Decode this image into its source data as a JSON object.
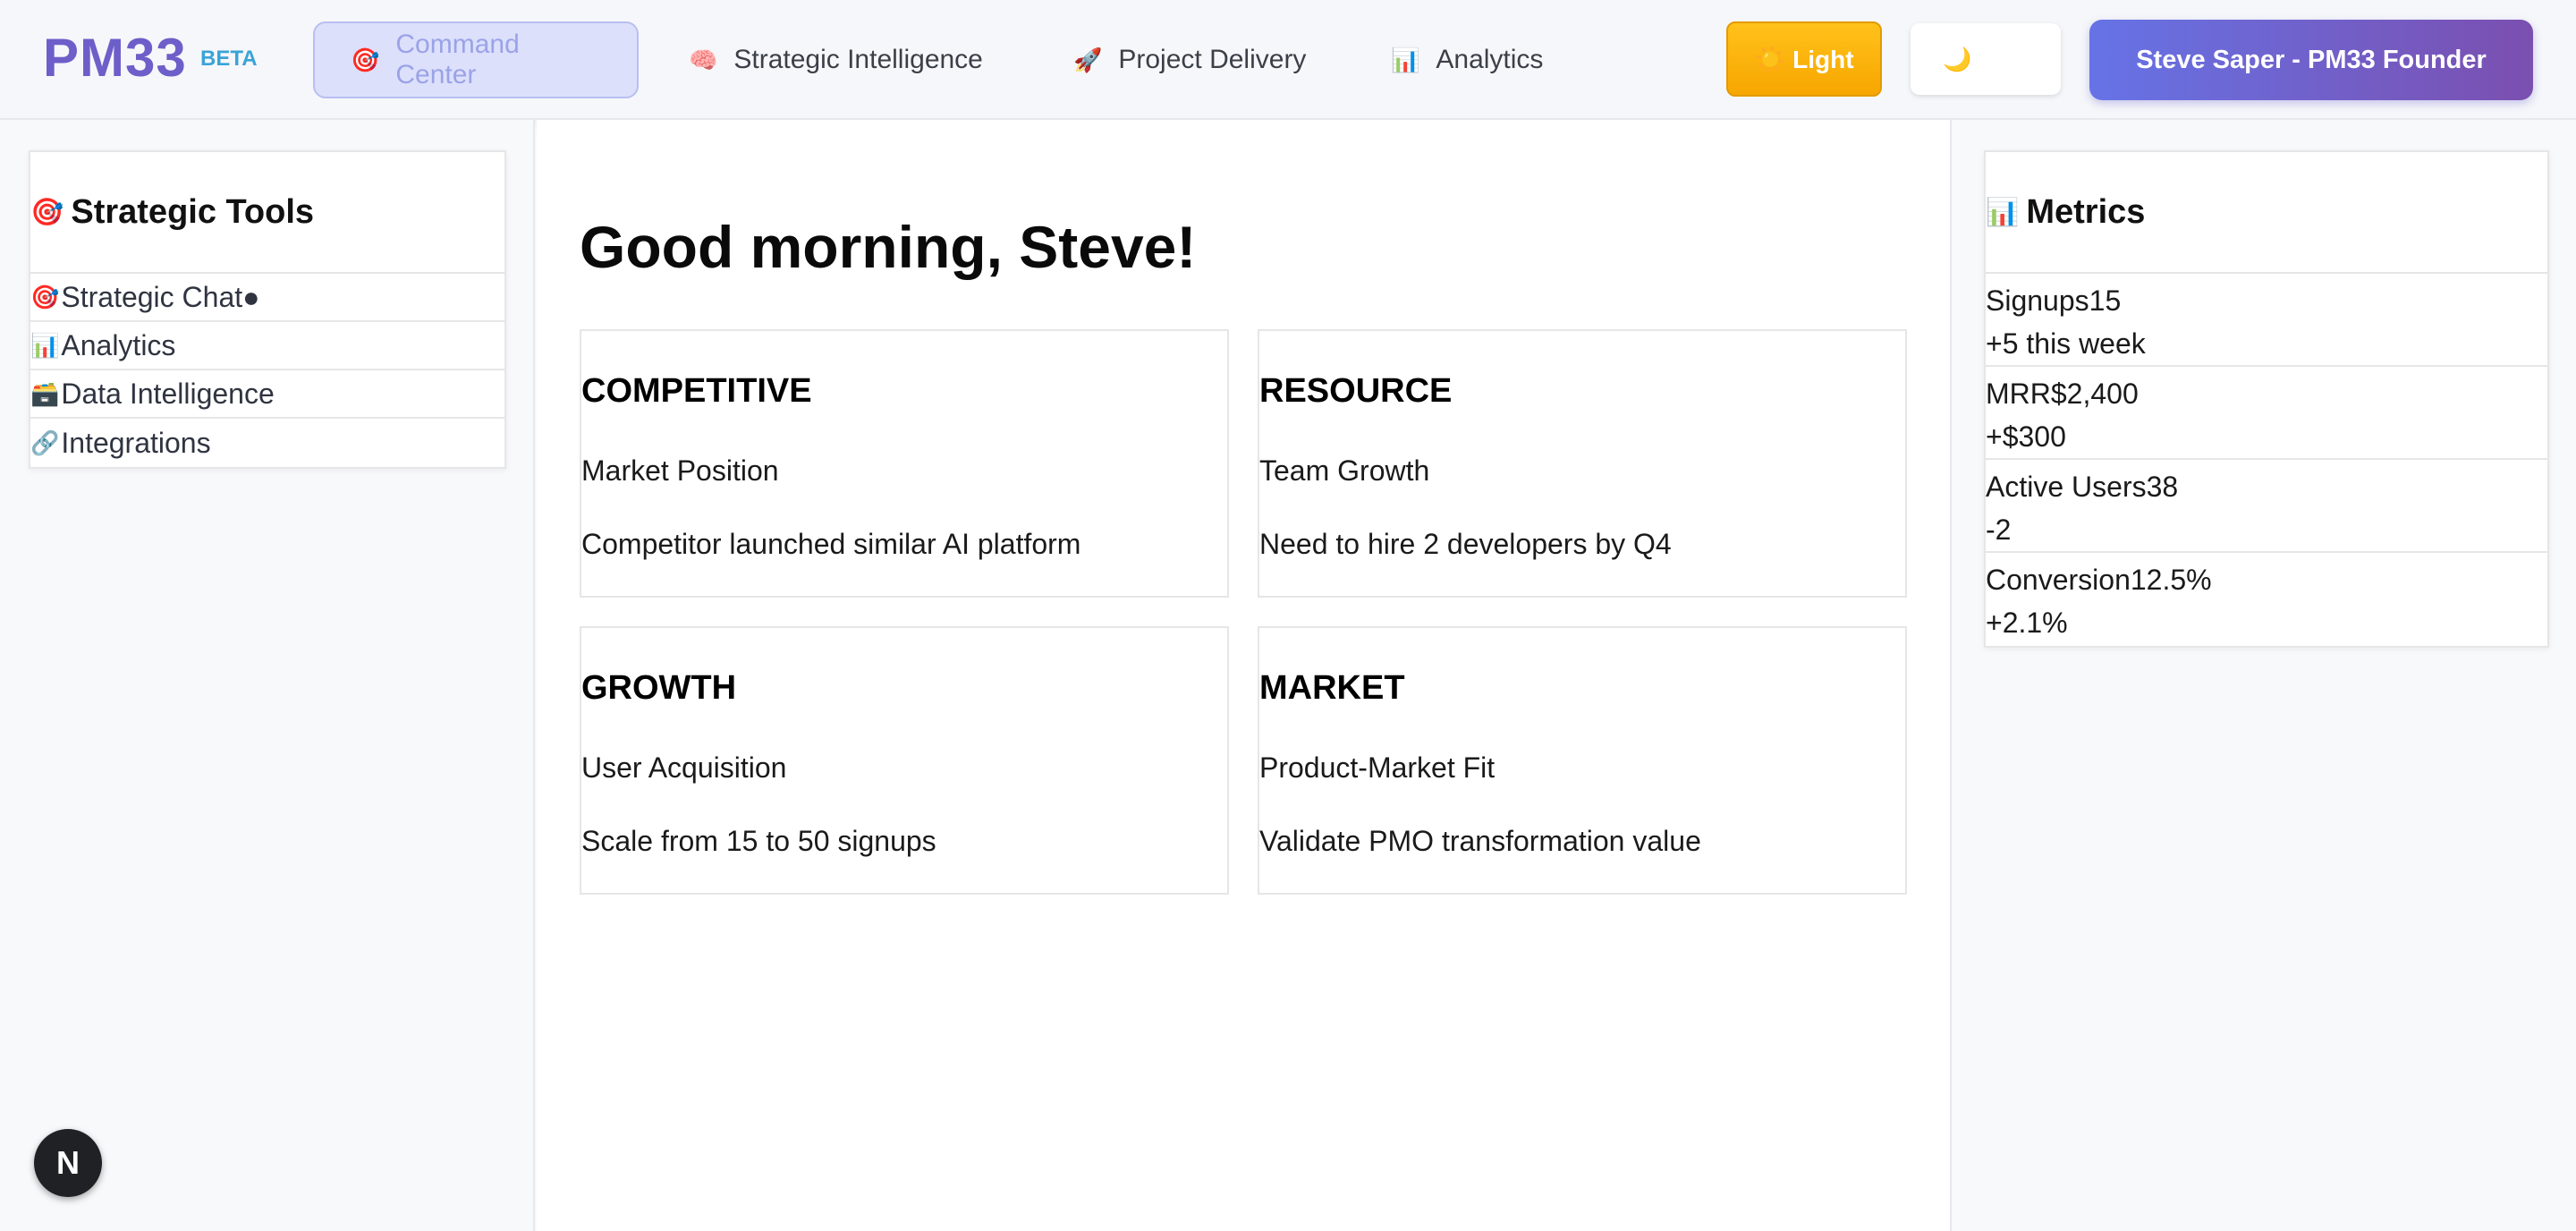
{
  "header": {
    "logo": "PM33",
    "beta": "BETA",
    "nav": [
      {
        "icon": "🎯",
        "label": "Command Center"
      },
      {
        "icon": "🧠",
        "label": "Strategic Intelligence"
      },
      {
        "icon": "🚀",
        "label": "Project Delivery"
      },
      {
        "icon": "📊",
        "label": "Analytics"
      }
    ],
    "light_button": "☀️ Light",
    "dark_button": "🌙",
    "user_button": "Steve Saper - PM33 Founder"
  },
  "sidebar": {
    "title_icon": "🎯",
    "title": "Strategic Tools",
    "items": [
      {
        "icon": "🎯",
        "label": "Strategic Chat●"
      },
      {
        "icon": "📊",
        "label": "Analytics"
      },
      {
        "icon": "🗃️",
        "label": "Data Intelligence"
      },
      {
        "icon": "🔗",
        "label": "Integrations"
      }
    ]
  },
  "main": {
    "greeting": "Good morning, Steve!",
    "cards": [
      {
        "category": "COMPETITIVE",
        "title": "Market Position",
        "description": "Competitor launched similar AI platform"
      },
      {
        "category": "RESOURCE",
        "title": "Team Growth",
        "description": "Need to hire 2 developers by Q4"
      },
      {
        "category": "GROWTH",
        "title": "User Acquisition",
        "description": "Scale from 15 to 50 signups"
      },
      {
        "category": "MARKET",
        "title": "Product-Market Fit",
        "description": "Validate PMO transformation value"
      }
    ]
  },
  "metrics": {
    "title_icon": "📊",
    "title": "Metrics",
    "items": [
      {
        "label": "Signups",
        "value": "15",
        "change": "+5 this week"
      },
      {
        "label": "MRR",
        "value": "$2,400",
        "change": "+$300"
      },
      {
        "label": "Active Users",
        "value": "38",
        "change": "-2"
      },
      {
        "label": "Conversion",
        "value": "12.5%",
        "change": "+2.1%"
      }
    ]
  },
  "badge": "N",
  "colors": {
    "accent": "#6d5fc9",
    "beta": "#3aa3d8",
    "light_button": "#f7a600",
    "user_gradient_start": "#6673e6",
    "user_gradient_end": "#7b4fb0"
  }
}
